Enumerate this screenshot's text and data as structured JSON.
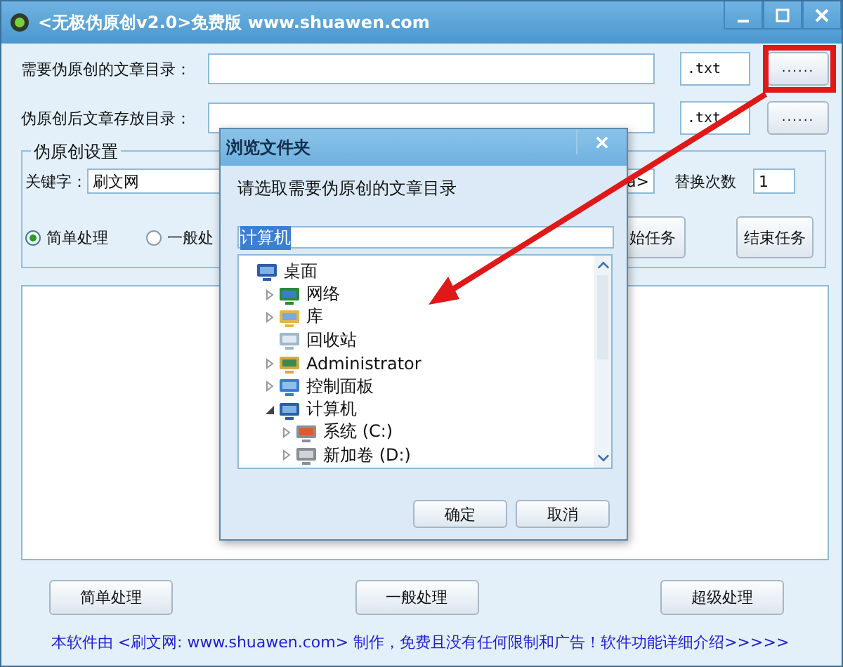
{
  "window": {
    "title": "<无极伪原创v2.0>免费版 www.shuawen.com"
  },
  "source_dir": {
    "label": "需要伪原创的文章目录：",
    "ext": ".txt",
    "browse": "......"
  },
  "output_dir": {
    "label": "伪原创后文章存放目录：",
    "ext": ".txt",
    "browse": "......"
  },
  "settings": {
    "legend": "伪原创设置",
    "keyword_label": "关键字：",
    "keyword": "刷文网",
    "link_field": "a>",
    "replace_label": "替换次数",
    "replace_count": "1",
    "modes": [
      {
        "label": "简单处理",
        "selected": true
      },
      {
        "label": "一般处",
        "selected": false
      }
    ],
    "start_button": "始任务",
    "stop_button": "结束任务"
  },
  "bottom_buttons": [
    "简单处理",
    "一般处理",
    "超级处理"
  ],
  "footer": "本软件由 <刷文网: www.shuawen.com> 制作，免费且没有任何限制和广告！软件功能详细介绍>>>>>",
  "dialog": {
    "title": "浏览文件夹",
    "prompt": "请选取需要伪原创的文章目录",
    "folder": "计算机",
    "folder_selected": true,
    "tree": [
      {
        "label": "桌面",
        "expandable": false,
        "children": [
          {
            "label": "网络",
            "expandable": true,
            "expanded": false
          },
          {
            "label": "库",
            "expandable": true,
            "expanded": false
          },
          {
            "label": "回收站",
            "expandable": false
          },
          {
            "label": "Administrator",
            "expandable": true,
            "expanded": false
          },
          {
            "label": "控制面板",
            "expandable": true,
            "expanded": false
          },
          {
            "label": "计算机",
            "expandable": true,
            "expanded": true,
            "children": [
              {
                "label": "系统 (C:)",
                "expandable": true,
                "expanded": false
              },
              {
                "label": "新加卷 (D:)",
                "expandable": true,
                "expanded": false
              }
            ]
          }
        ]
      }
    ],
    "buttons": [
      "确定",
      "取消"
    ]
  }
}
